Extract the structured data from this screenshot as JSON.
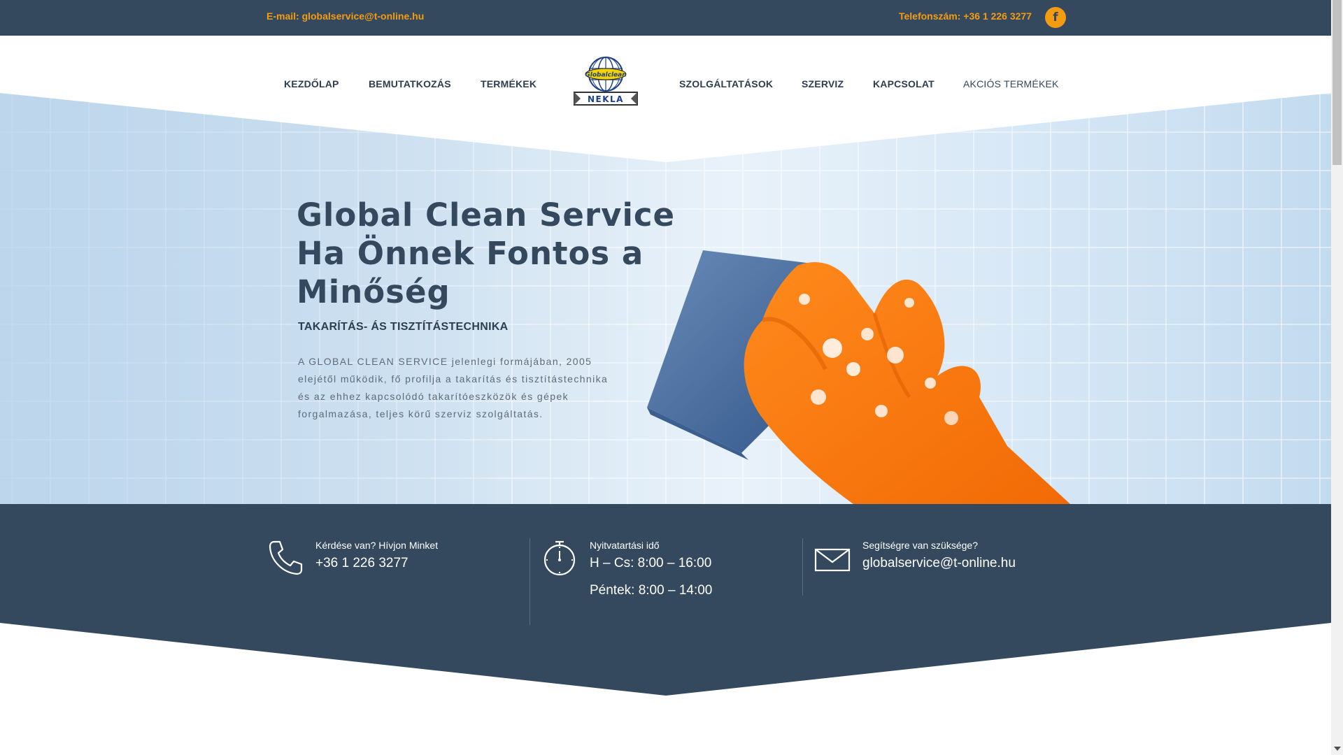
{
  "topbar": {
    "email": "E-mail: globalservice@t-online.hu",
    "phone": "Telefonszám: +36 1 226 3277",
    "facebook_icon": "facebook-icon",
    "accent_color": "#f39c12",
    "background_color": "#34495e"
  },
  "nav": {
    "items": [
      {
        "label": "KEZDŐLAP"
      },
      {
        "label": "BEMUTATKOZÁS"
      },
      {
        "label": "TERMÉKEK"
      },
      {
        "label": "SZOLGÁLTATÁSOK"
      },
      {
        "label": "SZERVIZ"
      },
      {
        "label": "KAPCSOLAT"
      },
      {
        "label": "AKCIÓS TERMÉKEK"
      }
    ],
    "logo": {
      "top_text": "Globalclean",
      "bottom_text": "NEKLA"
    }
  },
  "hero": {
    "title_lines": [
      "Global Clean Service",
      "Ha Önnek Fontos a",
      "Minőség"
    ],
    "subtitle": "TAKARÍTÁS- ÁS TISZTÍTÁSTECHNIKA",
    "text": "A GLOBAL CLEAN SERVICE jelenlegi formájában, 2005 elejétől működik, fő profilja a takarítás és tisztítástechnika és az ehhez kapcsolódó takarítóeszközök és gépek forgalmazása, teljes körű szerviz szolgáltatás."
  },
  "info": {
    "call": {
      "label": "Kérdése van? Hívjon Minket",
      "value": "+36 1 226 3277",
      "icon": "phone-icon"
    },
    "hours": {
      "label": "Nyitvatartási idő",
      "value1": "H – Cs: 8:00 – 16:00",
      "value2": "Péntek: 8:00 – 14:00",
      "icon": "stopwatch-icon"
    },
    "help": {
      "label": "Segítségre van szüksége?",
      "value": "globalservice@t-online.hu",
      "icon": "envelope-icon"
    },
    "band_color": "#34495e"
  }
}
